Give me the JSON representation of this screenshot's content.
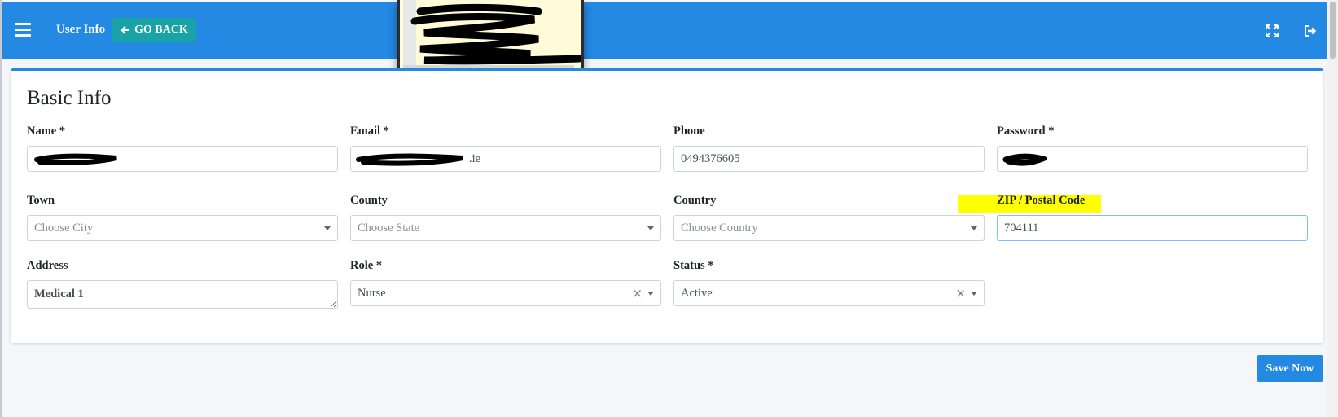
{
  "header": {
    "title": "User Info",
    "back_label": "GO BACK"
  },
  "form": {
    "section_title": "Basic Info",
    "name": {
      "label": "Name *",
      "value": ""
    },
    "email": {
      "label": "Email *",
      "value_suffix": ".ie"
    },
    "phone": {
      "label": "Phone",
      "value": "0494376605"
    },
    "password": {
      "label": "Password *",
      "value": ""
    },
    "town": {
      "label": "Town",
      "placeholder": "Choose City"
    },
    "county": {
      "label": "County",
      "placeholder": "Choose State"
    },
    "country": {
      "label": "Country",
      "placeholder": "Choose Country"
    },
    "zip": {
      "label": "ZIP / Postal Code",
      "value": "704111"
    },
    "address": {
      "label": "Address",
      "value": "Medical 1"
    },
    "role": {
      "label": "Role *",
      "value": "Nurse"
    },
    "status": {
      "label": "Status *",
      "value": "Active"
    }
  },
  "actions": {
    "save_label": "Save Now"
  },
  "icons": {
    "menu": "hamburger-icon",
    "back": "arrow-left-icon",
    "expand": "expand-icon",
    "logout": "logout-icon",
    "clear": "×"
  },
  "colors": {
    "header": "#2389e3",
    "back_button": "#1aa3a7",
    "save_button": "#2389e3",
    "highlight": "#ffff00"
  }
}
